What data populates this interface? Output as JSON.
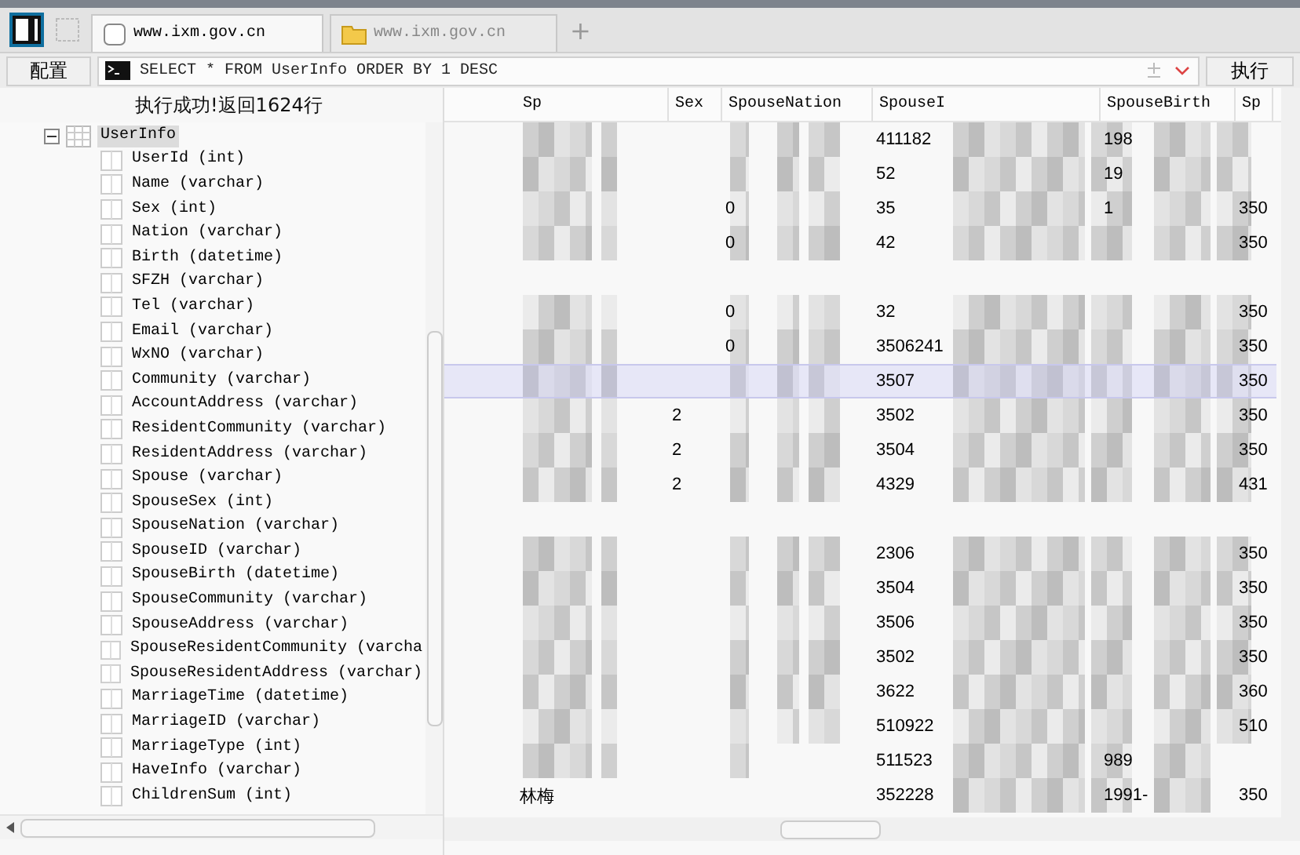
{
  "tabs": [
    {
      "label": "www.ixm.gov.cn",
      "selected": true,
      "kind": "database"
    },
    {
      "label": "www.ixm.gov.cn",
      "selected": false,
      "kind": "folder"
    }
  ],
  "new_tab_button": "+",
  "toolbar": {
    "config_button": "配置",
    "query": "SELECT * FROM UserInfo ORDER BY 1 DESC",
    "run_button": "执行"
  },
  "status": "执行成功!返回1624行",
  "tree": [
    {
      "label": "UserInfo",
      "expanded": true,
      "selected": true,
      "children": [
        {
          "label": "UserId (int)"
        },
        {
          "label": "Name (varchar)"
        },
        {
          "label": "Sex (int)"
        },
        {
          "label": "Nation (varchar)"
        },
        {
          "label": "Birth (datetime)"
        },
        {
          "label": "SFZH (varchar)"
        },
        {
          "label": "Tel (varchar)"
        },
        {
          "label": "Email (varchar)"
        },
        {
          "label": "WxNO (varchar)"
        },
        {
          "label": "Community (varchar)"
        },
        {
          "label": "AccountAddress (varchar)"
        },
        {
          "label": "ResidentCommunity (varchar)"
        },
        {
          "label": "ResidentAddress (varchar)"
        },
        {
          "label": "Spouse (varchar)"
        },
        {
          "label": "SpouseSex (int)"
        },
        {
          "label": "SpouseNation (varchar)"
        },
        {
          "label": "SpouseID (varchar)"
        },
        {
          "label": "SpouseBirth (datetime)"
        },
        {
          "label": "SpouseCommunity (varchar)"
        },
        {
          "label": "SpouseAddress (varchar)"
        },
        {
          "label": "SpouseResidentCommunity (varcha"
        },
        {
          "label": "SpouseResidentAddress (varchar)"
        },
        {
          "label": "MarriageTime (datetime)"
        },
        {
          "label": "MarriageID (varchar)"
        },
        {
          "label": "MarriageType (int)"
        },
        {
          "label": "HaveInfo (varchar)"
        },
        {
          "label": "ChildrenSum (int)"
        }
      ]
    }
  ],
  "table": {
    "columns": [
      "Sp",
      "Sex",
      "SpouseNation",
      "SpouseI",
      "SpouseBirth",
      "Sp"
    ],
    "rows": [
      {
        "selected": false,
        "cells": [
          null,
          null,
          null,
          "411182",
          "198",
          null
        ]
      },
      {
        "selected": false,
        "cells": [
          null,
          null,
          null,
          "52",
          "19",
          null
        ]
      },
      {
        "selected": false,
        "cells": [
          null,
          null,
          "0",
          "35",
          "1",
          "350"
        ]
      },
      {
        "selected": false,
        "cells": [
          null,
          null,
          "0",
          "42",
          null,
          "350"
        ]
      },
      {
        "selected": false,
        "cells": [
          null,
          null,
          null,
          null,
          null,
          null
        ]
      },
      {
        "selected": false,
        "cells": [
          null,
          null,
          "0",
          "32",
          null,
          "350"
        ]
      },
      {
        "selected": false,
        "cells": [
          null,
          null,
          "0",
          "3506241",
          null,
          "350"
        ]
      },
      {
        "selected": true,
        "cells": [
          null,
          null,
          null,
          "3507",
          null,
          "350"
        ]
      },
      {
        "selected": false,
        "cells": [
          null,
          "2",
          null,
          "3502",
          null,
          "350"
        ]
      },
      {
        "selected": false,
        "cells": [
          null,
          "2",
          null,
          "3504",
          null,
          "350"
        ]
      },
      {
        "selected": false,
        "cells": [
          null,
          "2",
          null,
          "4329",
          null,
          "431"
        ]
      },
      {
        "selected": false,
        "cells": [
          null,
          null,
          null,
          null,
          null,
          null
        ]
      },
      {
        "selected": false,
        "cells": [
          null,
          null,
          null,
          "2306",
          null,
          "350"
        ]
      },
      {
        "selected": false,
        "cells": [
          null,
          null,
          null,
          "3504",
          null,
          "350"
        ]
      },
      {
        "selected": false,
        "cells": [
          null,
          null,
          null,
          "3506",
          null,
          "350"
        ]
      },
      {
        "selected": false,
        "cells": [
          null,
          null,
          null,
          "3502",
          null,
          "350"
        ]
      },
      {
        "selected": false,
        "cells": [
          null,
          null,
          null,
          "3622",
          null,
          "360"
        ]
      },
      {
        "selected": false,
        "cells": [
          null,
          null,
          null,
          "510922",
          null,
          "510"
        ]
      },
      {
        "selected": false,
        "cells": [
          null,
          null,
          null,
          "511523",
          "989",
          null
        ]
      },
      {
        "selected": false,
        "cells": [
          "林梅",
          null,
          null,
          "352228",
          "1991-",
          "350"
        ]
      }
    ]
  }
}
